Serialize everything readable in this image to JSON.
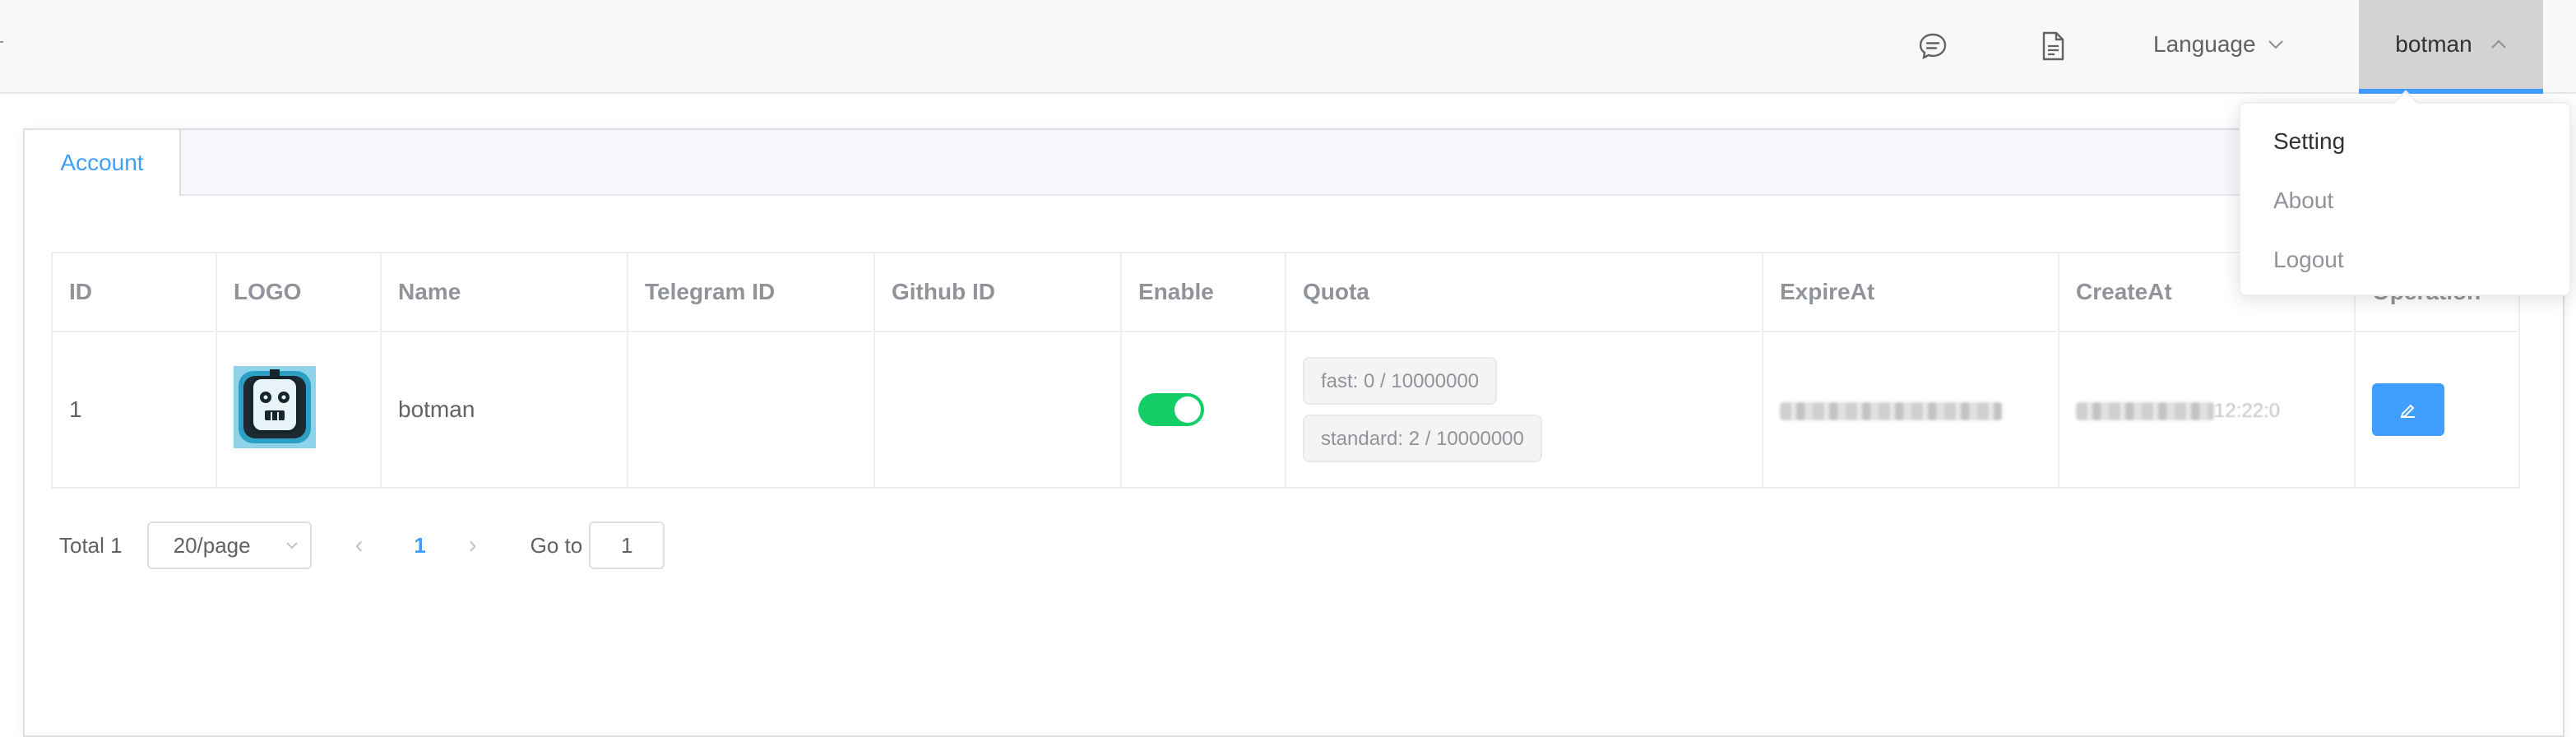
{
  "header": {
    "language_label": "Language",
    "user_name": "botman",
    "icons": [
      "chat-icon",
      "document-icon"
    ]
  },
  "tabs": [
    {
      "label": "Account",
      "active": true
    }
  ],
  "table": {
    "columns": [
      "ID",
      "LOGO",
      "Name",
      "Telegram ID",
      "Github ID",
      "Enable",
      "Quota",
      "ExpireAt",
      "CreateAt",
      "Operation"
    ],
    "rows": [
      {
        "id": "1",
        "name": "botman",
        "telegram_id": "",
        "github_id": "",
        "enabled": true,
        "quota": [
          "fast: 0 / 10000000",
          "standard: 2 / 10000000"
        ],
        "create_at_tail": "12:22:0"
      }
    ]
  },
  "pagination": {
    "total_label": "Total 1",
    "page_size_label": "20/page",
    "current_page": "1",
    "goto_label": "Go to",
    "goto_value": "1"
  },
  "user_menu": {
    "items": [
      "Setting",
      "About",
      "Logout"
    ]
  },
  "colors": {
    "primary": "#409eff",
    "switch_on": "#13ce66",
    "user_bg": "#d3d3d3"
  }
}
